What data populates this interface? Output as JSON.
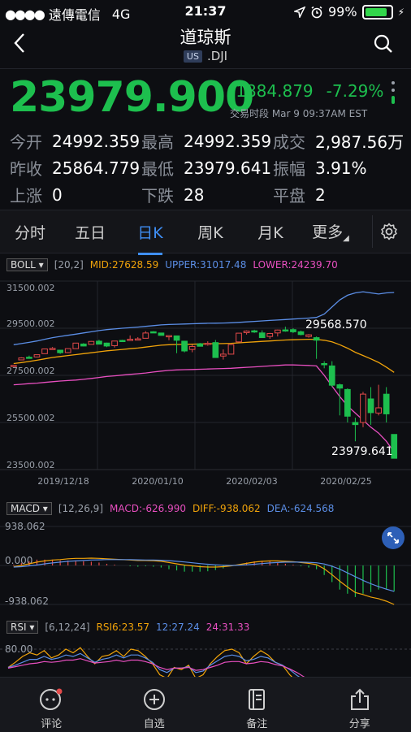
{
  "status_bar": {
    "carrier": "遠傳電信",
    "network": "4G",
    "time": "21:37",
    "battery": "99%"
  },
  "header": {
    "title": "道琼斯",
    "market_badge": "US",
    "symbol": ".DJI"
  },
  "quote": {
    "price": "23979.900",
    "change": "-1884.879",
    "change_pct": "-7.29%",
    "session": "交易时段 Mar 9 09:37AM EST"
  },
  "stats": [
    [
      {
        "k": "今开",
        "v": "24992.359"
      },
      {
        "k": "最高",
        "v": "24992.359"
      },
      {
        "k": "成交",
        "v": "2,987.56万"
      }
    ],
    [
      {
        "k": "昨收",
        "v": "25864.779"
      },
      {
        "k": "最低",
        "v": "23979.641"
      },
      {
        "k": "振幅",
        "v": "3.91%"
      }
    ],
    [
      {
        "k": "上涨",
        "v": "0"
      },
      {
        "k": "下跌",
        "v": "28"
      },
      {
        "k": "平盘",
        "v": "2"
      }
    ]
  ],
  "tabs": [
    "分时",
    "五日",
    "日K",
    "周K",
    "月K",
    "更多"
  ],
  "colors": {
    "up": "#e34a4a",
    "down": "#1dbf4e",
    "mid": "#f0a30a",
    "upper": "#5b8ee6",
    "lower": "#e84fc0",
    "accent": "#3f8ff5"
  },
  "boll": {
    "name": "BOLL",
    "params": "[20,2]",
    "mid": "MID:27628.59",
    "upper": "UPPER:31017.48",
    "lower": "LOWER:24239.70"
  },
  "macd": {
    "name": "MACD",
    "params": "[12,26,9]",
    "macd": "MACD:-626.990",
    "diff": "DIFF:-938.062",
    "dea": "DEA:-624.568"
  },
  "rsi": {
    "name": "RSI",
    "params": "[6,12,24]",
    "rsi6": "RSI6:23.57",
    "rsi12": "12:27.24",
    "rsi24": "24:31.33"
  },
  "tabbar": [
    "评论",
    "自选",
    "备注",
    "分享"
  ],
  "chart_data": [
    {
      "type": "candlestick",
      "title": "BOLL",
      "y_ticks": [
        "31500.002",
        "29500.002",
        "27500.002",
        "25500.002",
        "23500.002"
      ],
      "ylim": [
        23500,
        31500
      ],
      "x_ticks": [
        "2019/12/18",
        "2020/01/10",
        "2020/02/03",
        "2020/02/25"
      ],
      "annotations": {
        "high_label": "29568.570",
        "low_label": "23979.641"
      },
      "candles": [
        [
          27911,
          27934,
          27881,
          27922
        ],
        [
          28155,
          28267,
          28150,
          28240
        ],
        [
          28270,
          28337,
          28235,
          28267
        ],
        [
          28280,
          28376,
          28266,
          28376
        ],
        [
          28420,
          28621,
          28412,
          28621
        ],
        [
          28638,
          28701,
          28614,
          28645
        ],
        [
          28569,
          28569,
          28410,
          28462
        ],
        [
          28466,
          28635,
          28445,
          28634
        ],
        [
          28633,
          28873,
          28633,
          28869
        ],
        [
          28830,
          28866,
          28726,
          28745
        ],
        [
          28813,
          28954,
          28813,
          28940
        ],
        [
          28950,
          29010,
          28823,
          28824
        ],
        [
          28870,
          28890,
          28700,
          28745
        ],
        [
          28760,
          28960,
          28680,
          28956
        ],
        [
          28983,
          29009,
          28920,
          28939
        ],
        [
          29009,
          29193,
          29007,
          29031
        ],
        [
          29043,
          29122,
          29011,
          29048
        ],
        [
          29074,
          29374,
          29070,
          29297
        ],
        [
          29350,
          29374,
          29313,
          29349
        ],
        [
          29297,
          29301,
          29212,
          29196
        ],
        [
          29153,
          29170,
          28990,
          29186
        ],
        [
          29175,
          29186,
          28440,
          28989
        ],
        [
          28950,
          28955,
          28476,
          28535
        ],
        [
          28600,
          28811,
          28480,
          28723
        ],
        [
          28839,
          28876,
          28734,
          28734
        ],
        [
          28820,
          28944,
          28760,
          28859
        ],
        [
          28890,
          29000,
          28770,
          28256
        ],
        [
          28320,
          28600,
          28169,
          28400
        ],
        [
          28400,
          28830,
          28390,
          28807
        ],
        [
          28920,
          29153,
          28890,
          29290
        ],
        [
          29310,
          29408,
          29231,
          29380
        ],
        [
          29390,
          29436,
          29300,
          29379
        ],
        [
          29300,
          29410,
          29250,
          29102
        ],
        [
          29150,
          29300,
          29050,
          29277
        ],
        [
          29300,
          29440,
          29150,
          29423
        ],
        [
          29430,
          29568,
          29350,
          29398
        ],
        [
          29440,
          29500,
          29300,
          29348
        ],
        [
          29350,
          29400,
          29200,
          29232
        ],
        [
          29150,
          29250,
          29100,
          29220
        ],
        [
          29100,
          29150,
          28200,
          28992
        ],
        [
          28000,
          28100,
          27800,
          27961
        ],
        [
          27900,
          28100,
          27000,
          27081
        ],
        [
          27100,
          27150,
          25800,
          26957
        ],
        [
          26900,
          26950,
          25500,
          25766
        ],
        [
          25500,
          25700,
          24700,
          25409
        ],
        [
          25500,
          26800,
          25300,
          26703
        ],
        [
          26500,
          27000,
          25400,
          25917
        ],
        [
          25900,
          27100,
          25800,
          26121
        ],
        [
          26700,
          27000,
          25500,
          25864
        ],
        [
          24992,
          24992,
          23979,
          23979
        ]
      ],
      "series": [
        {
          "name": "MID",
          "values": [
            28000,
            28040,
            28090,
            28140,
            28200,
            28260,
            28300,
            28340,
            28380,
            28420,
            28460,
            28500,
            28540,
            28570,
            28600,
            28630,
            28660,
            28700,
            28740,
            28780,
            28800,
            28810,
            28815,
            28820,
            28830,
            28840,
            28845,
            28850,
            28860,
            28880,
            28900,
            28920,
            28940,
            28960,
            28980,
            29000,
            29010,
            29020,
            29030,
            29020,
            28990,
            28920,
            28800,
            28650,
            28480,
            28340,
            28200,
            28050,
            27850,
            27628
          ]
        },
        {
          "name": "UPPER",
          "values": [
            28800,
            28850,
            28900,
            28960,
            29030,
            29100,
            29150,
            29200,
            29250,
            29300,
            29350,
            29400,
            29440,
            29470,
            29500,
            29520,
            29550,
            29580,
            29610,
            29640,
            29660,
            29670,
            29680,
            29690,
            29700,
            29710,
            29715,
            29720,
            29730,
            29750,
            29770,
            29790,
            29810,
            29830,
            29850,
            29870,
            29890,
            29910,
            29930,
            29960,
            30100,
            30400,
            30700,
            30900,
            31000,
            31050,
            31000,
            30950,
            31000,
            31017
          ]
        },
        {
          "name": "LOWER",
          "values": [
            27100,
            27120,
            27150,
            27170,
            27200,
            27230,
            27260,
            27280,
            27300,
            27330,
            27370,
            27410,
            27450,
            27480,
            27510,
            27540,
            27570,
            27600,
            27640,
            27680,
            27710,
            27730,
            27740,
            27750,
            27760,
            27770,
            27780,
            27790,
            27800,
            27820,
            27840,
            27860,
            27880,
            27900,
            27920,
            27940,
            27940,
            27930,
            27920,
            27900,
            27500,
            27050,
            26600,
            26200,
            25900,
            25600,
            25300,
            25050,
            24700,
            24240
          ]
        }
      ]
    },
    {
      "type": "line",
      "title": "MACD",
      "y_ticks": [
        "938.062",
        "0.000",
        "-938.062"
      ],
      "ylim": [
        -938.062,
        938.062
      ],
      "series": [
        {
          "name": "DIFF",
          "values": [
            -30,
            0,
            40,
            80,
            110,
            130,
            140,
            160,
            170,
            170,
            175,
            170,
            160,
            150,
            140,
            130,
            120,
            120,
            115,
            100,
            70,
            40,
            10,
            -10,
            -30,
            -40,
            -40,
            -30,
            -10,
            20,
            50,
            80,
            100,
            110,
            110,
            100,
            90,
            70,
            50,
            20,
            -80,
            -220,
            -380,
            -520,
            -650,
            -700,
            -760,
            -800,
            -860,
            -938
          ]
        },
        {
          "name": "DEA",
          "values": [
            -40,
            -30,
            -10,
            10,
            40,
            60,
            80,
            100,
            110,
            120,
            130,
            135,
            140,
            140,
            140,
            140,
            135,
            130,
            130,
            125,
            115,
            100,
            85,
            65,
            45,
            30,
            15,
            5,
            0,
            5,
            15,
            30,
            45,
            60,
            70,
            80,
            80,
            80,
            75,
            65,
            35,
            -20,
            -90,
            -180,
            -270,
            -360,
            -440,
            -510,
            -570,
            -624
          ]
        },
        {
          "name": "MACD",
          "values": [
            20,
            60,
            100,
            140,
            140,
            140,
            120,
            120,
            120,
            100,
            90,
            70,
            40,
            20,
            0,
            -20,
            -30,
            -20,
            -30,
            -50,
            -90,
            -120,
            -150,
            -150,
            -150,
            -140,
            -110,
            -70,
            -20,
            30,
            70,
            100,
            110,
            100,
            80,
            40,
            20,
            -20,
            -50,
            -90,
            -230,
            -400,
            -580,
            -680,
            -760,
            -680,
            -640,
            -580,
            -580,
            -627
          ]
        }
      ]
    },
    {
      "type": "line",
      "title": "RSI",
      "y_ticks": [
        "80.00"
      ],
      "series": [
        {
          "name": "RSI6",
          "values": [
            55,
            62,
            70,
            75,
            72,
            78,
            68,
            72,
            80,
            75,
            82,
            70,
            60,
            70,
            72,
            78,
            70,
            80,
            78,
            70,
            60,
            45,
            40,
            55,
            52,
            58,
            40,
            45,
            60,
            70,
            78,
            80,
            75,
            60,
            70,
            78,
            72,
            62,
            58,
            45,
            35,
            28,
            26,
            30,
            25
          ]
        },
        {
          "name": "RSI12",
          "values": [
            55,
            58,
            62,
            66,
            66,
            70,
            66,
            68,
            72,
            70,
            74,
            68,
            62,
            66,
            68,
            72,
            68,
            72,
            72,
            68,
            62,
            52,
            48,
            54,
            54,
            56,
            48,
            50,
            58,
            64,
            70,
            72,
            70,
            64,
            66,
            70,
            68,
            62,
            58,
            52,
            44,
            38,
            32,
            30,
            27
          ]
        },
        {
          "name": "RSI24",
          "values": [
            54,
            56,
            58,
            60,
            61,
            63,
            62,
            63,
            65,
            65,
            67,
            64,
            61,
            62,
            63,
            65,
            63,
            65,
            65,
            63,
            60,
            55,
            52,
            54,
            54,
            55,
            51,
            52,
            55,
            58,
            62,
            63,
            63,
            60,
            61,
            63,
            62,
            59,
            57,
            53,
            48,
            42,
            37,
            34,
            31
          ]
        }
      ]
    }
  ]
}
